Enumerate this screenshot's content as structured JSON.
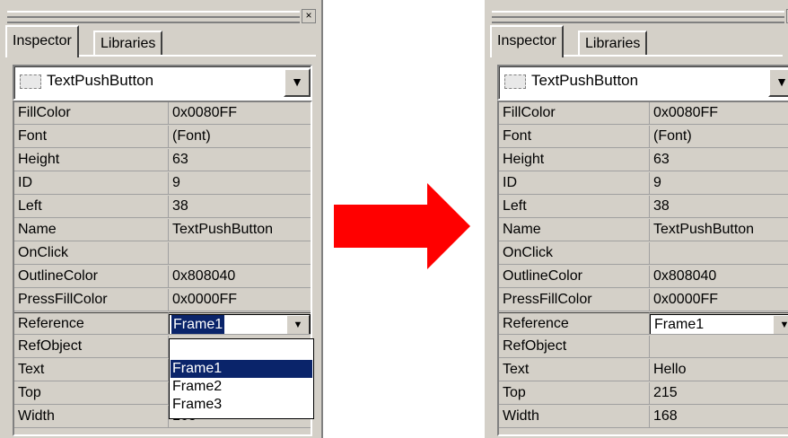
{
  "tabs": {
    "inspector": "Inspector",
    "libraries": "Libraries"
  },
  "object_selector": {
    "value": "TextPushButton"
  },
  "properties": [
    {
      "name": "FillColor",
      "value": "0x0080FF"
    },
    {
      "name": "Font",
      "value": "(Font)"
    },
    {
      "name": "Height",
      "value": "63"
    },
    {
      "name": "ID",
      "value": "9"
    },
    {
      "name": "Left",
      "value": "38"
    },
    {
      "name": "Name",
      "value": "TextPushButton"
    },
    {
      "name": "OnClick",
      "value": ""
    },
    {
      "name": "OutlineColor",
      "value": "0x808040"
    },
    {
      "name": "PressFillColor",
      "value": "0x0000FF"
    },
    {
      "name": "Reference",
      "value": "Frame1"
    },
    {
      "name": "RefObject",
      "value": ""
    },
    {
      "name": "Text",
      "value": ""
    },
    {
      "name": "Top",
      "value": ""
    },
    {
      "name": "Width",
      "value": "168"
    }
  ],
  "after_values": {
    "reference": "Frame1",
    "refobject": "",
    "text": "Hello",
    "top": "215",
    "width": "168"
  },
  "dropdown_options": [
    "",
    "Frame1",
    "Frame2",
    "Frame3"
  ],
  "close_glyph": "×",
  "dropdown_arrow": "▼",
  "colors": {
    "arrow": "#ff0000",
    "selection": "#0a246a",
    "panel": "#d4d0c8"
  }
}
